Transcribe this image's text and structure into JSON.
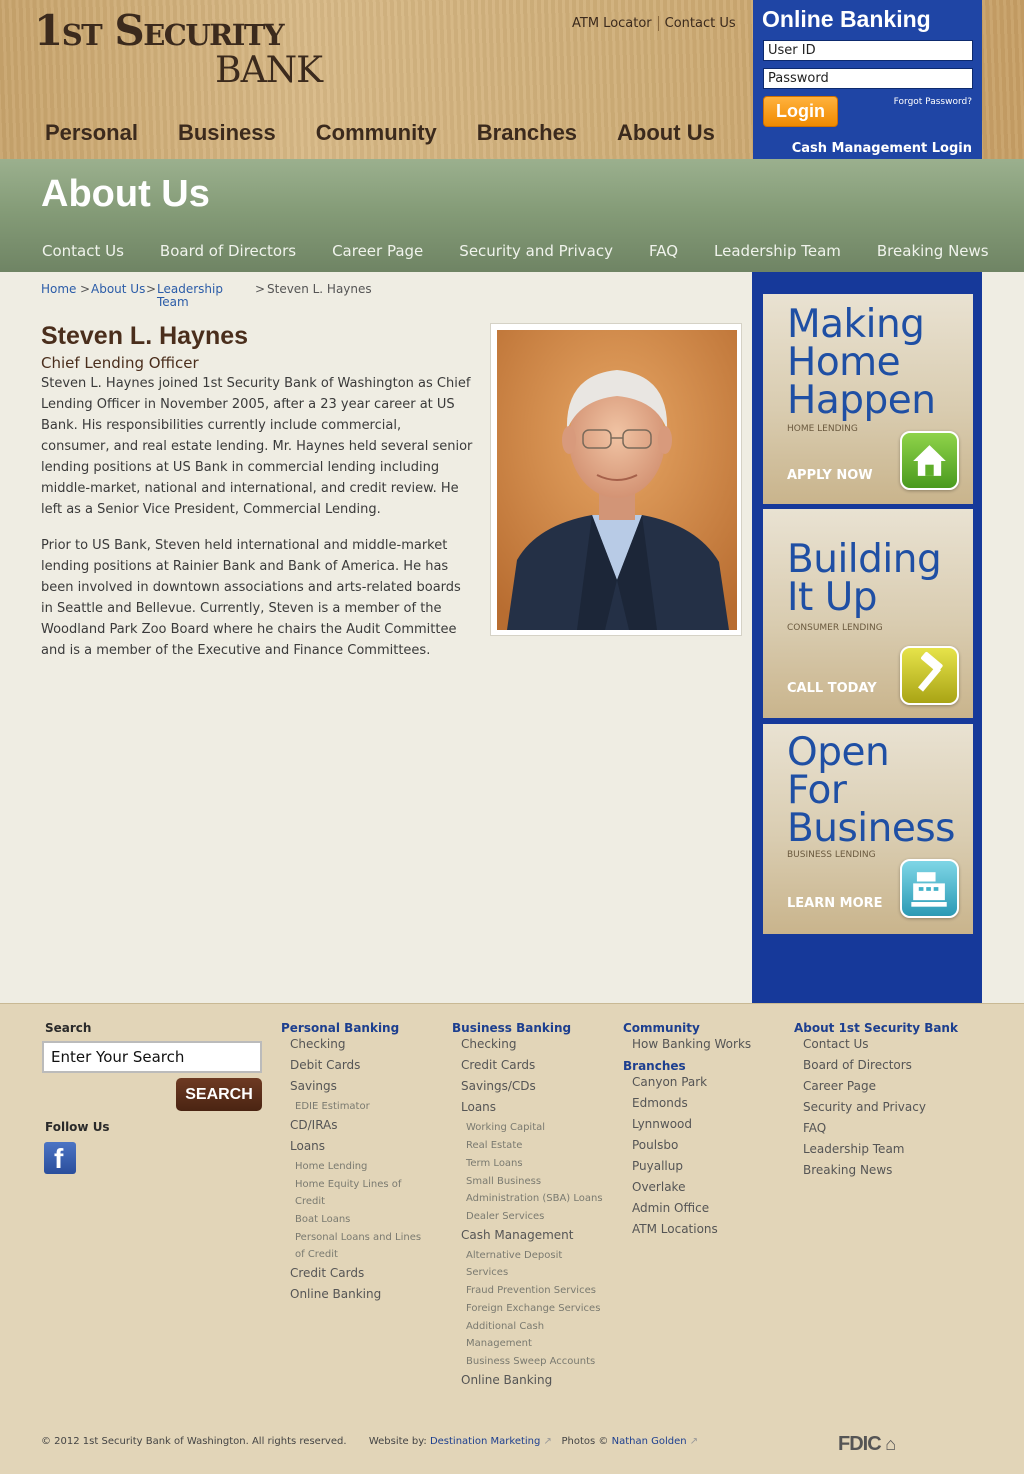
{
  "header": {
    "logo_line1": "1st Security",
    "logo_line2": "BANK",
    "utility_links": [
      "ATM Locator",
      "Contact Us"
    ],
    "main_nav": [
      "Personal",
      "Business",
      "Community",
      "Branches",
      "About Us"
    ]
  },
  "online_banking": {
    "title": "Online Banking",
    "user_placeholder": "User ID",
    "password_placeholder": "Password",
    "login_label": "Login",
    "forgot_label": "Forgot Password?",
    "cash_mgmt_label": "Cash Management Login"
  },
  "section": {
    "title": "About Us",
    "subnav": [
      "Contact Us",
      "Board of Directors",
      "Career Page",
      "Security and Privacy",
      "FAQ",
      "Leadership Team",
      "Breaking News"
    ]
  },
  "breadcrumb": {
    "home": "Home",
    "about": "About Us",
    "leadership_1": "Leadership",
    "leadership_2": "Team",
    "current": "Steven L. Haynes"
  },
  "profile": {
    "name": "Steven L. Haynes",
    "title": "Chief Lending Officer",
    "bio1": "Steven L. Haynes joined 1st Security Bank of Washington as Chief Lending Officer in November 2005, after a 23 year career at US Bank. His responsibilities currently include commercial, consumer, and real estate lending. Mr. Haynes held several senior lending positions at US Bank in commercial lending including middle-market, national and international, and credit review. He left as a Senior Vice President, Commercial Lending.",
    "bio2": "Prior to US Bank, Steven held international and middle-market lending positions at Rainier Bank and Bank of America. He has been involved in downtown associations and arts-related boards in Seattle and Bellevue. Currently, Steven is a member of the Woodland Park Zoo Board where he chairs the Audit Committee and is a member of the Executive and Finance Committees."
  },
  "promos": [
    {
      "lines": [
        "Making",
        "Home",
        "Happen"
      ],
      "category": "HOME LENDING",
      "cta": "APPLY NOW",
      "icon": "house-icon",
      "color": "#5fae2a"
    },
    {
      "lines": [
        "Building",
        "It Up"
      ],
      "category": "CONSUMER LENDING",
      "cta": "CALL TODAY",
      "icon": "hammer-icon",
      "color": "#c9c51c"
    },
    {
      "lines": [
        "Open",
        "For",
        "Business"
      ],
      "category": "BUSINESS LENDING",
      "cta": "LEARN MORE",
      "icon": "cash-register-icon",
      "color": "#3fb1c8"
    }
  ],
  "footer": {
    "search_label": "Search",
    "search_placeholder": "Enter Your Search",
    "search_button": "SEARCH",
    "follow_label": "Follow Us",
    "personal": {
      "heading": "Personal Banking",
      "items": [
        "Checking",
        "Debit Cards",
        "Savings",
        "EDIE Estimator",
        "CD/IRAs",
        "Loans",
        "Home Lending",
        "Home Equity Lines of",
        "Credit",
        "Boat Loans",
        "Personal Loans and Lines",
        "of Credit",
        "Credit Cards",
        "Online Banking"
      ]
    },
    "business": {
      "heading": "Business Banking",
      "items": [
        "Checking",
        "Credit Cards",
        "Savings/CDs",
        "Loans",
        "Working Capital",
        "Real Estate",
        "Term Loans",
        "Small Business",
        "Administration (SBA) Loans",
        "Dealer Services",
        "Cash Management",
        "Alternative Deposit",
        "Services",
        "Fraud Prevention Services",
        "Foreign Exchange Services",
        "Additional Cash",
        "Management",
        "Business Sweep Accounts",
        "Online Banking"
      ]
    },
    "community": {
      "heading": "Community",
      "items": [
        "How Banking Works"
      ],
      "branches_heading": "Branches",
      "branches": [
        "Canyon Park",
        "Edmonds",
        "Lynnwood",
        "Poulsbo",
        "Puyallup",
        "Overlake",
        "Admin Office",
        "ATM Locations"
      ]
    },
    "about": {
      "heading": "About 1st Security Bank",
      "items": [
        "Contact Us",
        "Board of Directors",
        "Career Page",
        "Security and Privacy",
        "FAQ",
        "Leadership Team",
        "Breaking News"
      ]
    },
    "copyright": "© 2012 1st Security Bank of Washington. All rights reserved.",
    "website_by_label": "Website by:",
    "website_by": "Destination Marketing",
    "photos_label": "Photos ©",
    "photos_by": "Nathan Golden",
    "fdic": "FDIC"
  }
}
